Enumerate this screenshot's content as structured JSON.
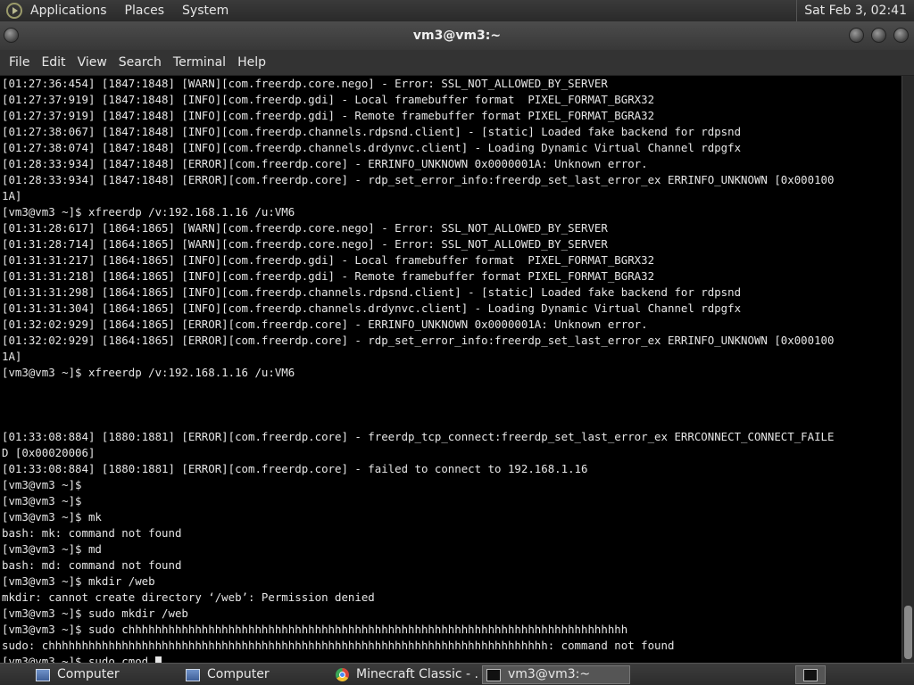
{
  "topbar": {
    "menus": [
      "Applications",
      "Places",
      "System"
    ],
    "clock": "Sat Feb  3, 02:41"
  },
  "window": {
    "title": "vm3@vm3:~"
  },
  "menubar": [
    "File",
    "Edit",
    "View",
    "Search",
    "Terminal",
    "Help"
  ],
  "terminal": {
    "lines": [
      "[01:27:36:454] [1847:1848] [WARN][com.freerdp.core.nego] - Error: SSL_NOT_ALLOWED_BY_SERVER",
      "[01:27:37:919] [1847:1848] [INFO][com.freerdp.gdi] - Local framebuffer format  PIXEL_FORMAT_BGRX32",
      "[01:27:37:919] [1847:1848] [INFO][com.freerdp.gdi] - Remote framebuffer format PIXEL_FORMAT_BGRA32",
      "[01:27:38:067] [1847:1848] [INFO][com.freerdp.channels.rdpsnd.client] - [static] Loaded fake backend for rdpsnd",
      "[01:27:38:074] [1847:1848] [INFO][com.freerdp.channels.drdynvc.client] - Loading Dynamic Virtual Channel rdpgfx",
      "[01:28:33:934] [1847:1848] [ERROR][com.freerdp.core] - ERRINFO_UNKNOWN 0x0000001A: Unknown error.",
      "[01:28:33:934] [1847:1848] [ERROR][com.freerdp.core] - rdp_set_error_info:freerdp_set_last_error_ex ERRINFO_UNKNOWN [0x000100",
      "1A]",
      "[vm3@vm3 ~]$ xfreerdp /v:192.168.1.16 /u:VM6",
      "[01:31:28:617] [1864:1865] [WARN][com.freerdp.core.nego] - Error: SSL_NOT_ALLOWED_BY_SERVER",
      "[01:31:28:714] [1864:1865] [WARN][com.freerdp.core.nego] - Error: SSL_NOT_ALLOWED_BY_SERVER",
      "[01:31:31:217] [1864:1865] [INFO][com.freerdp.gdi] - Local framebuffer format  PIXEL_FORMAT_BGRX32",
      "[01:31:31:218] [1864:1865] [INFO][com.freerdp.gdi] - Remote framebuffer format PIXEL_FORMAT_BGRA32",
      "[01:31:31:298] [1864:1865] [INFO][com.freerdp.channels.rdpsnd.client] - [static] Loaded fake backend for rdpsnd",
      "[01:31:31:304] [1864:1865] [INFO][com.freerdp.channels.drdynvc.client] - Loading Dynamic Virtual Channel rdpgfx",
      "[01:32:02:929] [1864:1865] [ERROR][com.freerdp.core] - ERRINFO_UNKNOWN 0x0000001A: Unknown error.",
      "[01:32:02:929] [1864:1865] [ERROR][com.freerdp.core] - rdp_set_error_info:freerdp_set_last_error_ex ERRINFO_UNKNOWN [0x000100",
      "1A]",
      "[vm3@vm3 ~]$ xfreerdp /v:192.168.1.16 /u:VM6",
      "",
      "",
      "",
      "[01:33:08:884] [1880:1881] [ERROR][com.freerdp.core] - freerdp_tcp_connect:freerdp_set_last_error_ex ERRCONNECT_CONNECT_FAILE",
      "D [0x00020006]",
      "[01:33:08:884] [1880:1881] [ERROR][com.freerdp.core] - failed to connect to 192.168.1.16",
      "[vm3@vm3 ~]$",
      "[vm3@vm3 ~]$",
      "[vm3@vm3 ~]$ mk",
      "bash: mk: command not found",
      "[vm3@vm3 ~]$ md",
      "bash: md: command not found",
      "[vm3@vm3 ~]$ mkdir /web",
      "mkdir: cannot create directory ‘/web’: Permission denied",
      "[vm3@vm3 ~]$ sudo mkdir /web",
      "[vm3@vm3 ~]$ sudo chhhhhhhhhhhhhhhhhhhhhhhhhhhhhhhhhhhhhhhhhhhhhhhhhhhhhhhhhhhhhhhhhhhhhhhhhhh",
      "sudo: chhhhhhhhhhhhhhhhhhhhhhhhhhhhhhhhhhhhhhhhhhhhhhhhhhhhhhhhhhhhhhhhhhhhhhhhhhh: command not found"
    ],
    "prompt_line": "[vm3@vm3 ~]$ sudo cmod "
  },
  "taskbar": {
    "items": [
      {
        "label": "Computer",
        "icon": "computer-icon"
      },
      {
        "label": "Computer",
        "icon": "computer-icon"
      },
      {
        "label": "Minecraft Classic - ...",
        "icon": "chrome-icon"
      },
      {
        "label": "vm3@vm3:~",
        "icon": "terminal-icon"
      }
    ]
  }
}
